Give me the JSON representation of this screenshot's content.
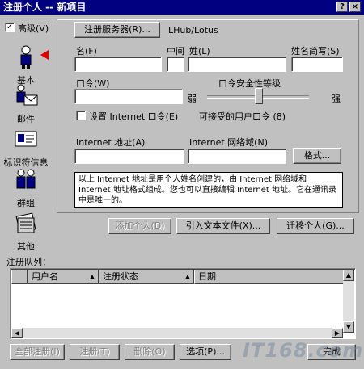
{
  "window": {
    "title": "注册个人 -- 新项目",
    "help_btn": "?",
    "close_btn": "×"
  },
  "advanced": {
    "label": "高级(V)",
    "checked": "✓"
  },
  "register_server": {
    "button": "注册服务器(R)...",
    "value": "LHub/Lotus"
  },
  "sidebar": {
    "items": [
      {
        "label": "基本"
      },
      {
        "label": "邮件"
      },
      {
        "label": "标识符信息"
      },
      {
        "label": "群组"
      },
      {
        "label": "其他"
      }
    ]
  },
  "form": {
    "first_name": "名(F)",
    "middle": "中间",
    "last_name": "姓(L)",
    "short_name": "姓名简写(S)",
    "password": "口令(W)",
    "strength_label": "口令安全性等级",
    "weak": "弱",
    "strong": "强",
    "set_internet_pw": "设置 Internet 口令(E)",
    "accepted_pw": "可接受的用户口令 (8)",
    "internet_address": "Internet 地址(A)",
    "internet_domain": "Internet 网络域(N)",
    "format_button": "格式...",
    "info_text": "以上 Internet 地址是用个人姓名创建的，由 Internet 网络域和 Internet 地址格式组成。您也可以直接编辑 Internet 地址。它在通讯录中是唯一的。"
  },
  "actions": {
    "add_person": "添加个人(D)",
    "import_text": "引入文本文件(X)...",
    "migrate": "迁移个人(G)..."
  },
  "queue": {
    "label": "注册队列：",
    "columns": [
      "用户名",
      "注册状态",
      "日期"
    ]
  },
  "bottom_buttons": {
    "register_all": "全部注册(I)",
    "register": "注册(T)",
    "delete": "删除(O)",
    "options": "选项(P)...",
    "done": "完成"
  },
  "watermark": "IT168.com"
}
